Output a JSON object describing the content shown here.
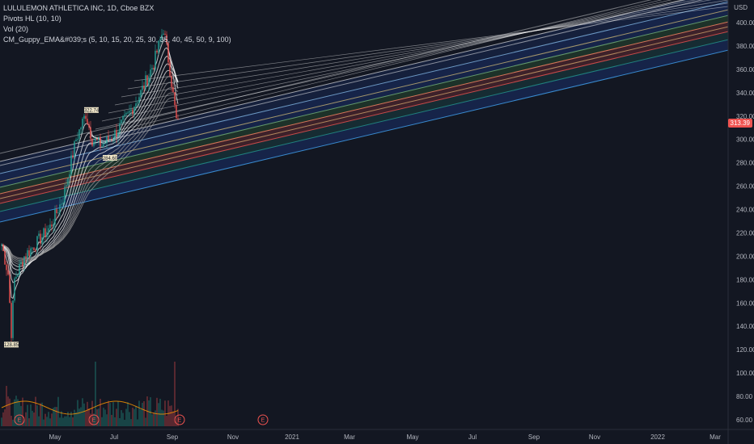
{
  "legend": {
    "title": "LULULEMON ATHLETICA INC, 1D, Cboe BZX",
    "pivots": "Pivots HL (10, 10)",
    "vol": "Vol (20)",
    "guppy": "CM_Guppy_EMA&#039;s (5, 10, 15, 20, 25, 30, 35, 40, 45, 50, 9, 100)"
  },
  "currency": "USD",
  "last_price": "313.39",
  "y_axis": {
    "ticks": [
      60,
      80,
      100,
      120,
      140,
      160,
      180,
      200,
      220,
      240,
      260,
      280,
      300,
      320,
      340,
      360,
      380,
      400
    ],
    "labels": [
      "60.00",
      "80.00",
      "100.00",
      "120.00",
      "140.00",
      "160.00",
      "180.00",
      "200.00",
      "220.00",
      "240.00",
      "260.00",
      "280.00",
      "300.00",
      "320.00",
      "340.00",
      "360.00",
      "380.00",
      "400.00"
    ]
  },
  "x_axis": {
    "labels": [
      "May",
      "Jul",
      "Sep",
      "Nov",
      "2021",
      "Mar",
      "May",
      "Jul",
      "Sep",
      "Nov",
      "2022",
      "Mar"
    ]
  },
  "pivots": [
    {
      "label": "128.85"
    },
    {
      "label": "322.74"
    },
    {
      "label": "284.60"
    }
  ],
  "earnings_marker": "E",
  "colors": {
    "background": "#131722",
    "up": "#26a69a",
    "down": "#ef5350",
    "ema_fast": "#ffffff",
    "ema_slow": "#9e9e9e"
  }
}
